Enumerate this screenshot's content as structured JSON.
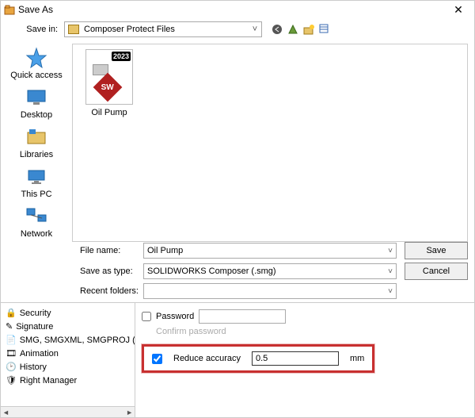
{
  "window": {
    "title": "Save As"
  },
  "save_in": {
    "label": "Save in:",
    "value": "Composer Protect Files"
  },
  "places": {
    "quick": "Quick access",
    "desktop": "Desktop",
    "libraries": "Libraries",
    "thispc": "This PC",
    "network": "Network"
  },
  "file_item": {
    "name": "Oil Pump",
    "year": "2023",
    "sw": "SW"
  },
  "form": {
    "filename_label": "File name:",
    "filename_value": "Oil Pump",
    "type_label": "Save as type:",
    "type_value": "SOLIDWORKS Composer (.smg)",
    "recent_label": "Recent folders:"
  },
  "buttons": {
    "save": "Save",
    "cancel": "Cancel"
  },
  "tree": {
    "security": "Security",
    "signature": "Signature",
    "smg": "SMG, SMGXML, SMGPROJ (",
    "animation": "Animation",
    "history": "History",
    "rightmgr": "Right Manager"
  },
  "detail": {
    "password_label": "Password",
    "confirm_label": "Confirm password",
    "reduce_label": "Reduce accuracy",
    "reduce_value": "0.5",
    "reduce_unit": "mm"
  },
  "glyphs": {
    "chevron": "˅",
    "back": "◄",
    "fwd": "►",
    "close": "✕"
  }
}
